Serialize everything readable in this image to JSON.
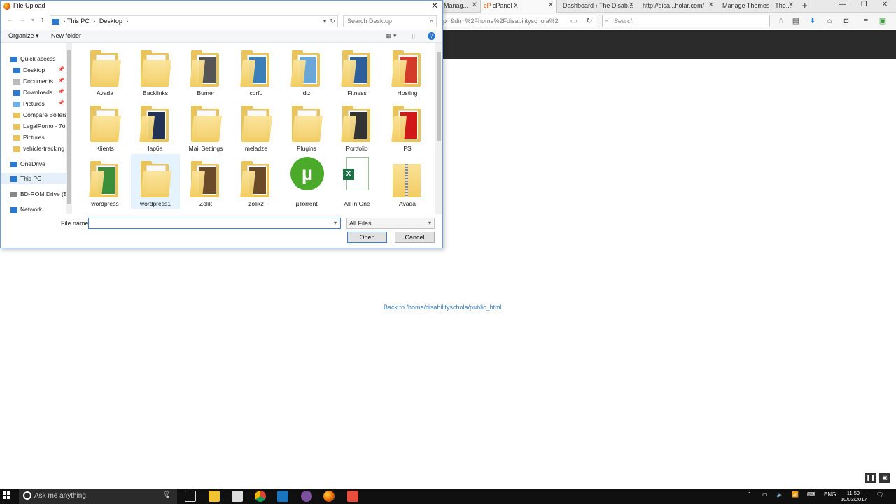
{
  "browser": {
    "tabs": [
      {
        "label": "Manag..."
      },
      {
        "label": "cPanel X"
      },
      {
        "label": "Dashboard ‹ The Disab..."
      },
      {
        "label": "http://disa...holar.com/"
      },
      {
        "label": "Manage Themes - The..."
      }
    ],
    "url": "p=&dir=%2Fhome%2Fdisabilityschola%2",
    "search_placeholder": "Search",
    "back_link": "Back to /home/disabilityschola/public_html"
  },
  "dialog": {
    "title": "File Upload",
    "breadcrumb": [
      "This PC",
      "Desktop"
    ],
    "search_placeholder": "Search Desktop",
    "toolbar": {
      "organize": "Organize ▾",
      "new_folder": "New folder"
    },
    "nav_items": [
      {
        "label": "Quick access",
        "icon": "star-icon"
      },
      {
        "label": "Desktop",
        "icon": "desktop-icon",
        "pinned": true
      },
      {
        "label": "Documents",
        "icon": "document-icon",
        "pinned": true
      },
      {
        "label": "Downloads",
        "icon": "download-icon",
        "pinned": true
      },
      {
        "label": "Pictures",
        "icon": "picture-icon",
        "pinned": true
      },
      {
        "label": "Compare Boilers",
        "icon": "folder-icon"
      },
      {
        "label": "LegalPorno - 7o",
        "icon": "folder-icon"
      },
      {
        "label": "Pictures",
        "icon": "folder-icon"
      },
      {
        "label": "vehicle-tracking",
        "icon": "folder-icon"
      },
      {
        "label": "OneDrive",
        "icon": "cloud-icon"
      },
      {
        "label": "This PC",
        "icon": "computer-icon"
      },
      {
        "label": "BD-ROM Drive (E:",
        "icon": "disc-icon"
      },
      {
        "label": "Network",
        "icon": "network-icon"
      }
    ],
    "files": [
      {
        "name": "Avada",
        "kind": "folder"
      },
      {
        "name": "Backlinks",
        "kind": "folder"
      },
      {
        "name": "Bumer",
        "kind": "folder-photo",
        "color": "#555555"
      },
      {
        "name": "corfu",
        "kind": "folder-photo",
        "color": "#3a7fb8"
      },
      {
        "name": "diz",
        "kind": "folder-photo",
        "color": "#6aa7d8"
      },
      {
        "name": "Fitness",
        "kind": "folder-photo",
        "color": "#2f5f9a"
      },
      {
        "name": "Hosting",
        "kind": "folder-photo",
        "color": "#d23a2a"
      },
      {
        "name": "Klients",
        "kind": "folder"
      },
      {
        "name": "lap6a",
        "kind": "folder-photo",
        "color": "#223355"
      },
      {
        "name": "Mail Settings",
        "kind": "folder"
      },
      {
        "name": "meladze",
        "kind": "folder"
      },
      {
        "name": "Plugins",
        "kind": "folder"
      },
      {
        "name": "Portfolio",
        "kind": "folder-photo",
        "color": "#333333"
      },
      {
        "name": "PS",
        "kind": "folder-photo",
        "color": "#d01818"
      },
      {
        "name": "wordpress",
        "kind": "folder-photo",
        "color": "#3b8f3b"
      },
      {
        "name": "wordpress1",
        "kind": "folder"
      },
      {
        "name": "Zolik",
        "kind": "folder-photo",
        "color": "#6b4a2a"
      },
      {
        "name": "zolik2",
        "kind": "folder-photo",
        "color": "#6b4a2a"
      },
      {
        "name": "µTorrent",
        "kind": "app",
        "color": "#4caa2a"
      },
      {
        "name": "All In One",
        "kind": "excel",
        "color": "#1e7145"
      },
      {
        "name": "Avada",
        "kind": "zip"
      }
    ],
    "file_name_label": "File name:",
    "file_name_value": "",
    "file_type": "All Files",
    "open_button": "Open",
    "cancel_button": "Cancel"
  },
  "taskbar": {
    "search_placeholder": "Ask me anything",
    "language": "ENG",
    "time": "11:59",
    "date": "10/03/2017"
  }
}
